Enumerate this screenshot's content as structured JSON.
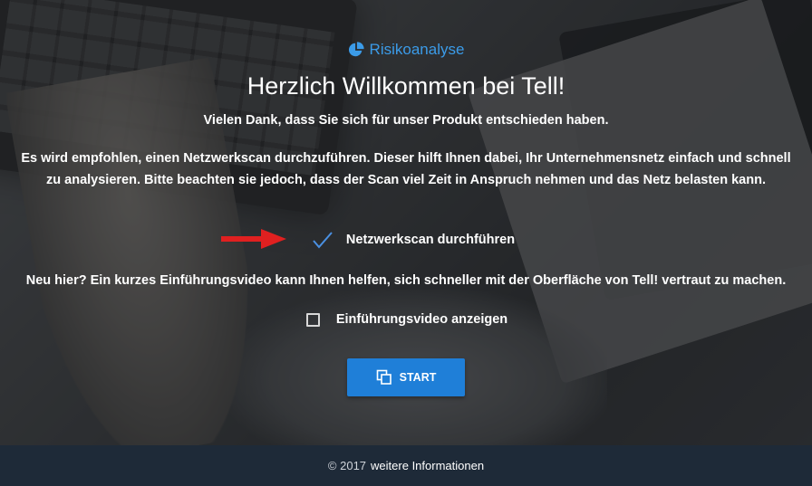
{
  "brand": {
    "label": "Risikoanalyse",
    "icon": "pie-chart-icon",
    "color": "#3b9be8"
  },
  "welcome": {
    "title": "Herzlich Willkommen bei Tell!",
    "subtitle": "Vielen Dank, dass Sie sich für unser Produkt entschieden haben.",
    "description": "Es wird empfohlen, einen Netzwerkscan durchzuführen. Dieser hilft Ihnen dabei, Ihr Unternehmensnetz einfach und schnell zu analysieren. Bitte beachten sie jedoch, dass der Scan viel Zeit in Anspruch nehmen und das Netz belasten kann."
  },
  "options": {
    "network_scan": {
      "label": "Netzwerkscan durchführen",
      "checked": true
    },
    "intro_text": "Neu hier? Ein kurzes Einführungsvideo kann Ihnen helfen, sich schneller mit der Oberfläche von Tell! vertraut zu machen.",
    "intro_video": {
      "label": "Einführungsvideo anzeigen",
      "checked": false
    }
  },
  "start_button": {
    "label": "START",
    "icon": "copy-icon",
    "color": "#1f7fd8"
  },
  "annotation": {
    "icon": "red-arrow-icon",
    "color": "#e02020"
  },
  "footer": {
    "copyright": "© 2017",
    "link": "weitere Informationen"
  }
}
